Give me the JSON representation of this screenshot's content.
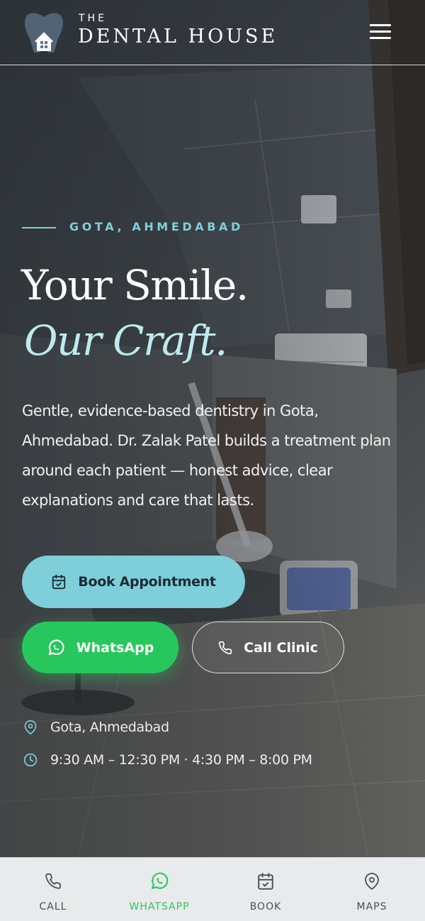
{
  "header": {
    "brand_top": "THE",
    "brand_name": "DENTAL HOUSE",
    "logo_icon": "tooth-house-logo",
    "menu_icon": "hamburger-menu-icon"
  },
  "hero": {
    "eyebrow": "GOTA, AHMEDABAD",
    "headline_line1": "Your Smile.",
    "headline_line2": "Our Craft.",
    "description": "Gentle, evidence-based dentistry in Gota, Ahmedabad. Dr. Zalak Patel builds a treatment plan around each patient — honest advice, clear explanations and care that lasts."
  },
  "actions": {
    "book_label": "Book Appointment",
    "whatsapp_label": "WhatsApp",
    "call_label": "Call Clinic"
  },
  "info": {
    "location": "Gota, Ahmedabad",
    "hours": "9:30 AM – 12:30 PM · 4:30 PM – 8:00 PM"
  },
  "bottom_nav": {
    "items": [
      {
        "label": "CALL",
        "icon": "phone-icon"
      },
      {
        "label": "WHATSAPP",
        "icon": "whatsapp-icon",
        "active": true
      },
      {
        "label": "BOOK",
        "icon": "calendar-icon"
      },
      {
        "label": "MAPS",
        "icon": "map-pin-icon"
      }
    ]
  },
  "colors": {
    "accent": "#7ecfd9",
    "accent_light": "#bfe9ee",
    "whatsapp": "#27c75e",
    "nav_bg": "#e9eaeb"
  }
}
